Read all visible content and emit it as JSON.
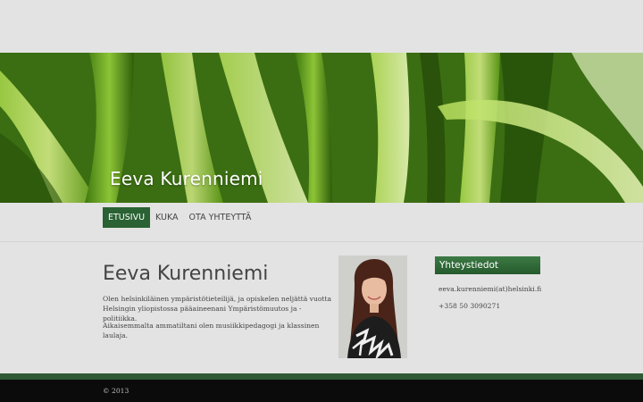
{
  "site": {
    "title": "Eeva Kurenniemi"
  },
  "nav": {
    "items": [
      {
        "label": "ETUSIVU",
        "active": true
      },
      {
        "label": "KUKA",
        "active": false
      },
      {
        "label": "OTA YHTEYTTÄ",
        "active": false
      }
    ]
  },
  "main": {
    "heading": "Eeva Kurenniemi",
    "paragraph1": "Olen helsinkiläinen ympäristötieteilijä, ja opiskelen neljättä vuotta Helsingin yliopistossa pääaineenani Ympäristömuutos ja -politiikka.",
    "paragraph2": "Aikaisemmalta ammatiltani olen musiikkipedagogi ja klassinen laulaja."
  },
  "sidebar": {
    "heading": "Yhteystiedot",
    "email": "eeva.kurenniemi(at)helsinki.fi",
    "phone": "+358 50 3090271"
  },
  "footer": {
    "copyright": "© 2013"
  },
  "colors": {
    "accent_green": "#2a6233",
    "footer_green": "#2f5a35",
    "footer_black": "#0b0b0b",
    "page_background": "#e3e3e3"
  }
}
